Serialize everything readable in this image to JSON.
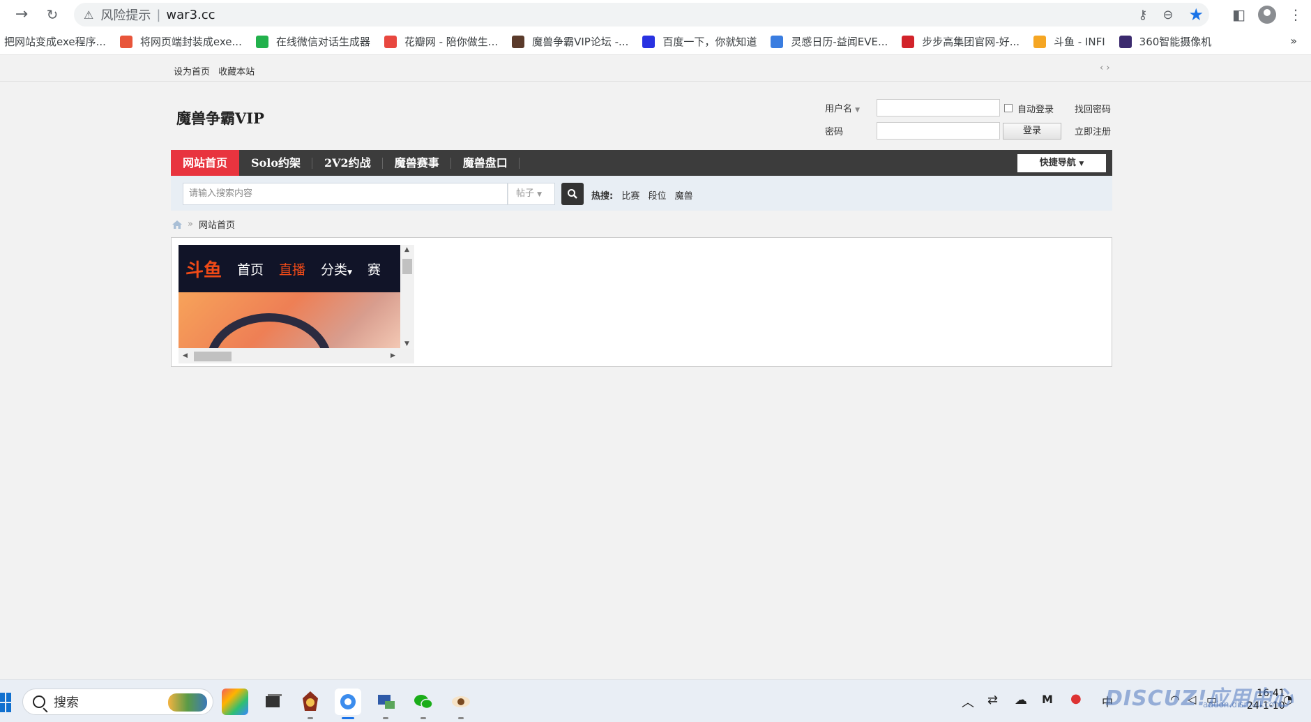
{
  "browser": {
    "risk_label": "风险提示",
    "url": "war3.cc"
  },
  "bookmarks": [
    {
      "label": "把网站变成exe程序...",
      "color": "#ffffff"
    },
    {
      "label": "将网页端封装成exe...",
      "color": "#e8553a"
    },
    {
      "label": "在线微信对话生成器",
      "color": "#22b14c"
    },
    {
      "label": "花瓣网 - 陪你做生...",
      "color": "#e8473f"
    },
    {
      "label": "魔兽争霸VIP论坛 -...",
      "color": "#5b3b2b"
    },
    {
      "label": "百度一下，你就知道",
      "color": "#2932e1"
    },
    {
      "label": "灵感日历-益闻EVE...",
      "color": "#3a7de0"
    },
    {
      "label": "步步高集团官网-好...",
      "color": "#d2232a"
    },
    {
      "label": "斗鱼 - INFI",
      "color": "#f5a623"
    },
    {
      "label": "360智能摄像机",
      "color": "#3b2a6e"
    }
  ],
  "bookmarks_more": "»",
  "topstrip": {
    "set_home": "设为首页",
    "bookmark_site": "收藏本站",
    "arrows": "‹ ›"
  },
  "site": {
    "logo": "魔兽争霸VIP"
  },
  "login": {
    "username_label": "用户名",
    "password_label": "密码",
    "auto_login": "自动登录",
    "forgot": "找回密码",
    "register": "立即注册",
    "login_button": "登录"
  },
  "nav": {
    "items": [
      "网站首页",
      "Solo约架",
      "2V2约战",
      "魔兽赛事",
      "魔兽盘口"
    ],
    "quick_nav": "快捷导航"
  },
  "search": {
    "placeholder": "请输入搜索内容",
    "type": "帖子",
    "hot_label": "热搜:",
    "hot": [
      "比赛",
      "段位",
      "魔兽"
    ]
  },
  "breadcrumb": {
    "current": "网站首页",
    "sep": "»"
  },
  "embed": {
    "logo": "斗鱼",
    "nav": [
      "首页",
      "直播",
      "分类",
      "赛"
    ]
  },
  "taskbar": {
    "search_label": "搜索",
    "ime": "中",
    "time": "16:41",
    "date": "24-1-10"
  },
  "watermark": {
    "brand": "DISCUZ!应用中心",
    "url": "addon.dismall.com"
  }
}
